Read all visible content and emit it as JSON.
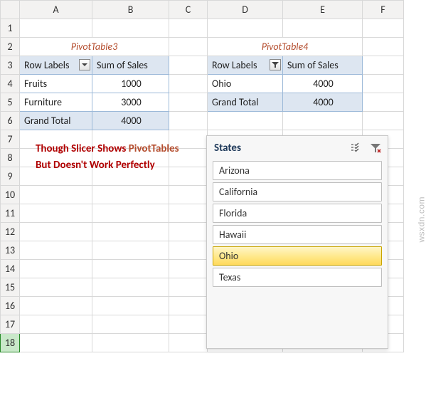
{
  "columns": [
    "A",
    "B",
    "C",
    "D",
    "E",
    "F"
  ],
  "rows": [
    "1",
    "2",
    "3",
    "4",
    "5",
    "6",
    "7",
    "8",
    "9",
    "10",
    "11",
    "12",
    "13",
    "14",
    "15",
    "16",
    "17",
    "18"
  ],
  "pivot3": {
    "title": "PivotTable3",
    "header_label": "Row Labels",
    "header_value": "Sum of Sales",
    "rows": [
      {
        "label": "Fruits",
        "value": "1000"
      },
      {
        "label": "Furniture",
        "value": "3000"
      }
    ],
    "total_label": "Grand Total",
    "total_value": "4000"
  },
  "pivot4": {
    "title": "PivotTable4",
    "header_label": "Row Labels",
    "header_value": "Sum of Sales",
    "rows": [
      {
        "label": "Ohio",
        "value": "4000"
      }
    ],
    "total_label": "Grand Total",
    "total_value": "4000"
  },
  "note": {
    "part1": "Though Slicer Shows",
    "part2": "PivotTables",
    "part3": " But Doesn't Work Perfectly"
  },
  "slicer": {
    "title": "States",
    "items": [
      {
        "label": "Arizona",
        "selected": false
      },
      {
        "label": "California",
        "selected": false
      },
      {
        "label": "Florida",
        "selected": false
      },
      {
        "label": "Hawaii",
        "selected": false
      },
      {
        "label": "Ohio",
        "selected": true
      },
      {
        "label": "Texas",
        "selected": false
      }
    ]
  },
  "watermark": "wsxdn.com"
}
